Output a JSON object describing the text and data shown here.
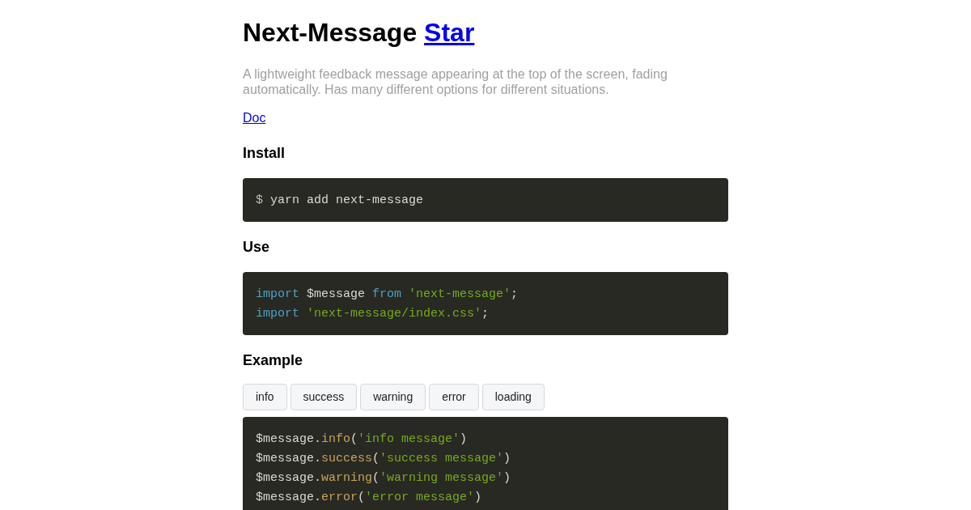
{
  "title": "Next-Message",
  "title_link": "Star",
  "description": "A lightweight feedback message appearing at the top of the screen, fading automatically. Has many different options for different situations.",
  "doc_link": "Doc",
  "sections": [
    {
      "heading": "Install",
      "code": [
        [
          {
            "kind": "prompt",
            "text": "$ "
          },
          {
            "kind": "plain",
            "text": "yarn add next-message"
          }
        ]
      ]
    },
    {
      "heading": "Use",
      "code": [
        [
          {
            "kind": "keyword",
            "text": "import"
          },
          {
            "kind": "plain",
            "text": " $message "
          },
          {
            "kind": "keyword",
            "text": "from "
          },
          {
            "kind": "string",
            "text": "'next-message'"
          },
          {
            "kind": "plain",
            "text": ";"
          }
        ],
        [
          {
            "kind": "keyword",
            "text": "import "
          },
          {
            "kind": "string",
            "text": "'next-message/index.css'"
          },
          {
            "kind": "plain",
            "text": ";"
          }
        ]
      ]
    },
    {
      "heading": "Example",
      "buttons": [
        "info",
        "success",
        "warning",
        "error",
        "loading"
      ],
      "code": [
        [
          {
            "kind": "plain",
            "text": "$message."
          },
          {
            "kind": "method",
            "text": "info"
          },
          {
            "kind": "plain",
            "text": "("
          },
          {
            "kind": "string",
            "text": "'info message'"
          },
          {
            "kind": "plain",
            "text": ")"
          }
        ],
        [
          {
            "kind": "plain",
            "text": "$message."
          },
          {
            "kind": "method",
            "text": "success"
          },
          {
            "kind": "plain",
            "text": "("
          },
          {
            "kind": "string",
            "text": "'success message'"
          },
          {
            "kind": "plain",
            "text": ")"
          }
        ],
        [
          {
            "kind": "plain",
            "text": "$message."
          },
          {
            "kind": "method",
            "text": "warning"
          },
          {
            "kind": "plain",
            "text": "("
          },
          {
            "kind": "string",
            "text": "'warning message'"
          },
          {
            "kind": "plain",
            "text": ")"
          }
        ],
        [
          {
            "kind": "plain",
            "text": "$message."
          },
          {
            "kind": "method",
            "text": "error"
          },
          {
            "kind": "plain",
            "text": "("
          },
          {
            "kind": "string",
            "text": "'error message'"
          },
          {
            "kind": "plain",
            "text": ")"
          }
        ]
      ]
    }
  ]
}
